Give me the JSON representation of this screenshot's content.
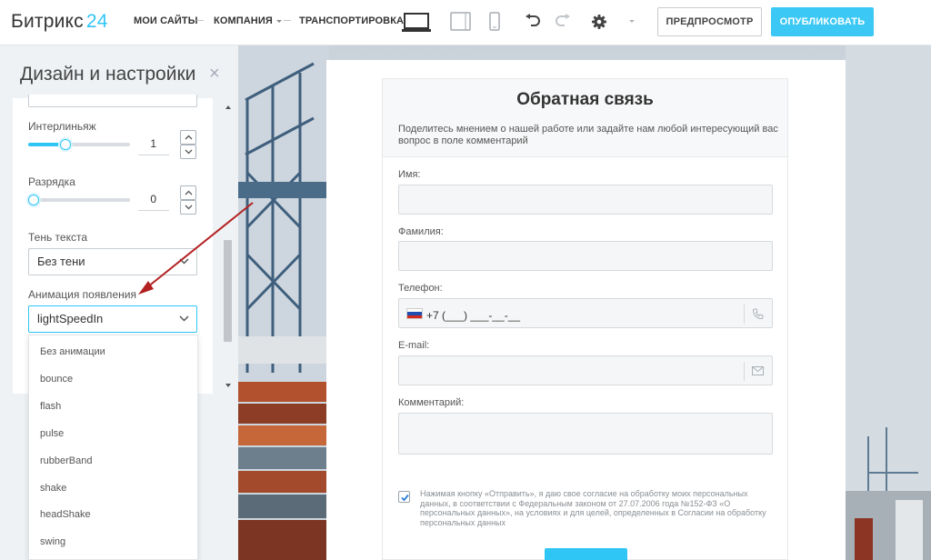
{
  "header": {
    "logo_name": "Битрикс",
    "logo_number": "24",
    "nav": [
      "МОИ САЙТЫ",
      "КОМПАНИЯ",
      "ТРАНСПОРТИРОВКА"
    ],
    "preview_label": "ПРЕДПРОСМОТР",
    "publish_label": "ОПУБЛИКОВАТЬ",
    "accent": "#3bc8f5"
  },
  "panel": {
    "title": "Дизайн и настройки",
    "close": "×",
    "line_height": {
      "label": "Интерлиньяж",
      "value": "1",
      "level": 0.35
    },
    "letter_spacing": {
      "label": "Разрядка",
      "value": "0",
      "level": 0.0
    },
    "text_shadow": {
      "label": "Тень текста",
      "value": "Без тени"
    },
    "animation": {
      "label": "Анимация появления",
      "value": "lightSpeedIn"
    },
    "animation_options": [
      "Без анимации",
      "bounce",
      "flash",
      "pulse",
      "rubberBand",
      "shake",
      "headShake",
      "swing"
    ]
  },
  "form": {
    "title": "Обратная связь",
    "description": "Поделитесь мнением о нашей работе или задайте нам любой интересующий вас вопрос в поле комментарий",
    "fields": {
      "name": "Имя:",
      "surname": "Фамилия:",
      "phone": "Телефон:",
      "email": "E-mail:",
      "comment": "Комментарий:"
    },
    "phone_mask": "+7 (___) ___-__-__",
    "consent": "Нажимая кнопку «Отправить», я даю свое согласие на обработку моих персональных данных, в соответствии с Федеральным законом от 27.07.2006 года №152-ФЗ «О персональных данных», на условиях и для целей, определенных в Согласии на обработку персональных данных"
  }
}
